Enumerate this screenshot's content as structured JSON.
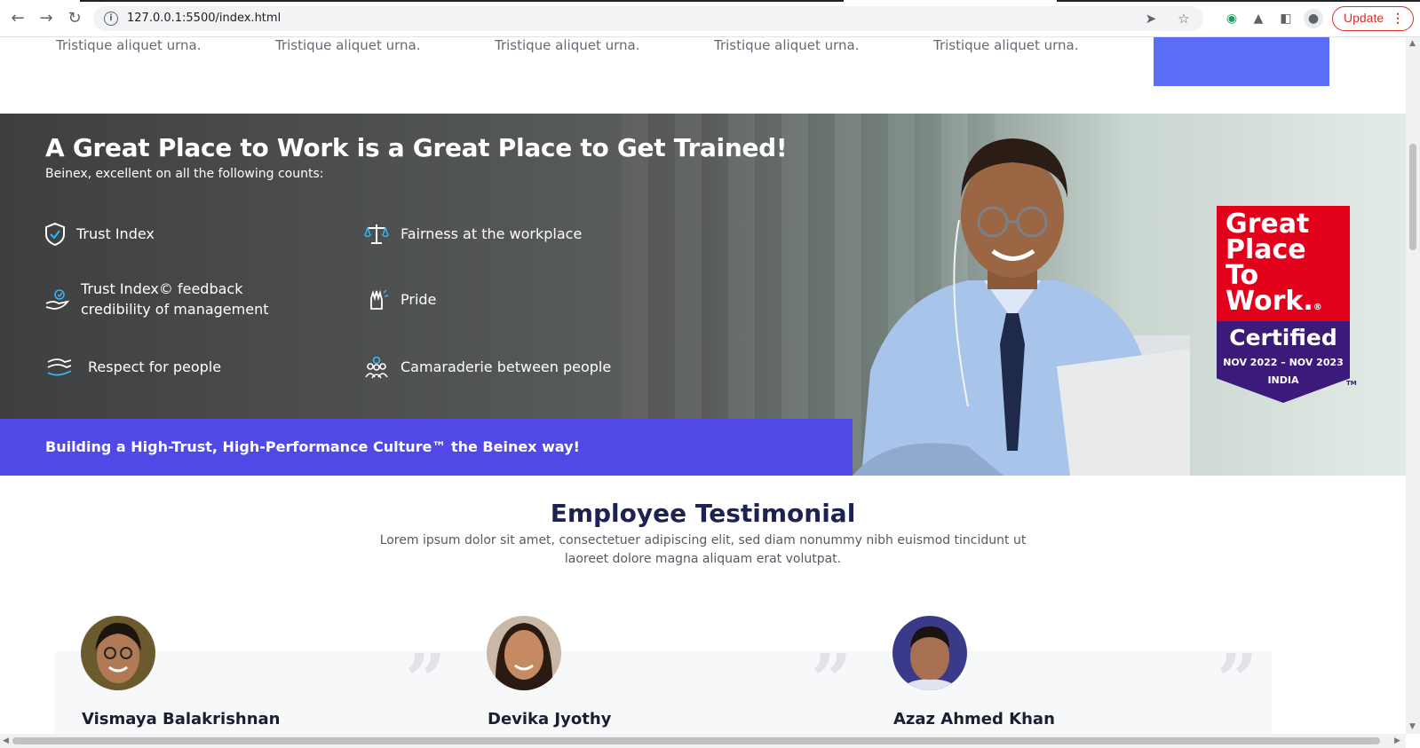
{
  "browser": {
    "url": "127.0.0.1:5500/index.html",
    "update_label": "Update"
  },
  "features_row": {
    "items": [
      "Tristique aliquet urna.",
      "Tristique aliquet urna.",
      "Tristique aliquet urna.",
      "Tristique aliquet urna.",
      "Tristique aliquet urna."
    ]
  },
  "hero": {
    "title": "A Great Place to Work is a Great Place to Get Trained!",
    "subtitle": "Beinex, excellent on all the following counts:",
    "points": [
      {
        "label": "Trust Index",
        "icon": "shield-check-icon"
      },
      {
        "label": "Fairness at the workplace",
        "icon": "scales-icon"
      },
      {
        "label_line1": "Trust Index© feedback",
        "label_line2": "credibility of management",
        "icon": "hand-check-icon"
      },
      {
        "label": "Pride",
        "icon": "raised-hand-icon"
      },
      {
        "label": "Respect for people",
        "icon": "handshake-icon"
      },
      {
        "label": "Camaraderie between people",
        "icon": "people-group-icon"
      }
    ],
    "banner_text": "Building a High-Trust, High-Performance Culture™ the Beinex way!",
    "badge": {
      "line1": "Great",
      "line2": "Place",
      "line3": "To",
      "line4": "Work.",
      "registered": "®",
      "certified": "Certified",
      "dates": "NOV 2022 – NOV 2023",
      "country": "INDIA",
      "tm": "TM"
    }
  },
  "testimonials": {
    "title": "Employee Testimonial",
    "description": "Lorem ipsum dolor sit amet, consectetuer adipiscing elit, sed diam nonummy nibh euismod tincidunt ut laoreet dolore magna aliquam erat volutpat.",
    "people": [
      {
        "name": "Vismaya Balakrishnan"
      },
      {
        "name": "Devika Jyothy"
      },
      {
        "name": "Azaz Ahmed Khan"
      }
    ],
    "quote_mark": "”"
  },
  "colors": {
    "accent_blue": "#5b6ef5",
    "banner_purple": "#5149e6",
    "title_navy": "#1c2354",
    "badge_red": "#e2001a",
    "badge_purple": "#3c1a7a"
  }
}
